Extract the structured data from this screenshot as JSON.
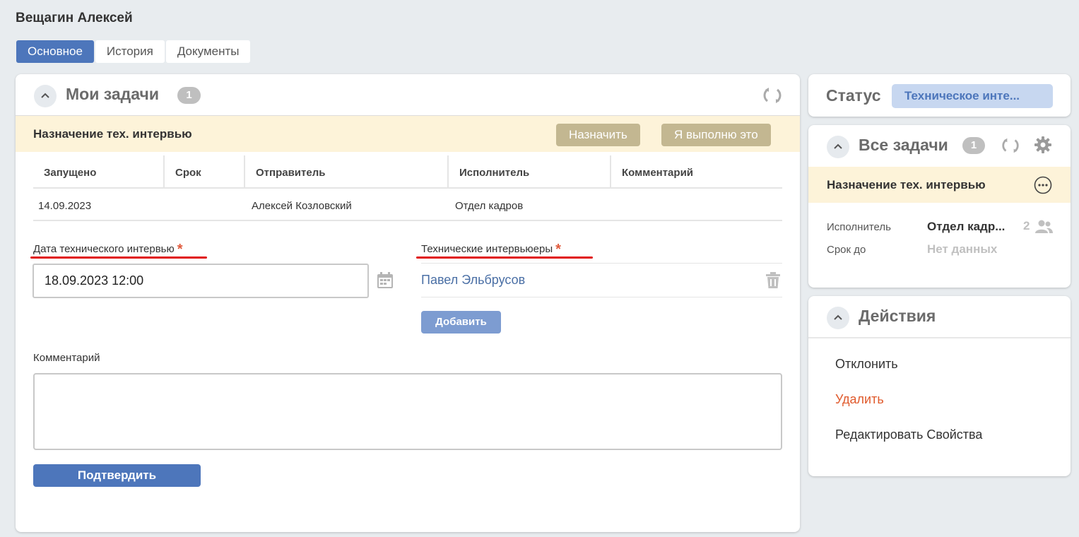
{
  "page": {
    "title": "Вещагин Алексей"
  },
  "tabs": [
    {
      "label": "Основное",
      "active": true
    },
    {
      "label": "История",
      "active": false
    },
    {
      "label": "Документы",
      "active": false
    }
  ],
  "my_tasks": {
    "title": "Мои задачи",
    "count": "1",
    "task_name": "Назначение тех. интервью",
    "assign_label": "Назначить",
    "self_label": "Я выполню это",
    "table": {
      "headers": [
        "Запущено",
        "Срок",
        "Отправитель",
        "Исполнитель",
        "Комментарий"
      ],
      "rows": [
        [
          "14.09.2023",
          "",
          "Алексей Козловский",
          "Отдел кадров",
          ""
        ]
      ]
    },
    "form": {
      "date_label": "Дата технического интервью",
      "date_value": "18.09.2023 12:00",
      "interviewers_label": "Технические интервьюеры",
      "interviewer": "Павел Эльбрусов",
      "add_label": "Добавить",
      "comment_label": "Комментарий",
      "comment_value": "",
      "confirm_label": "Подтвердить",
      "required_mark": "*"
    }
  },
  "status": {
    "label": "Статус",
    "value": "Техническое инте..."
  },
  "all_tasks": {
    "title": "Все задачи",
    "count": "1",
    "task_name": "Назначение тех. интервью",
    "executor_label": "Исполнитель",
    "executor_value": "Отдел кадр...",
    "executor_count": "2",
    "due_label": "Срок до",
    "due_value": "Нет данных"
  },
  "actions": {
    "title": "Действия",
    "items": [
      "Отклонить",
      "Удалить",
      "Редактировать Свойства"
    ]
  },
  "colors": {
    "accent": "#4d76bb",
    "banner": "#fdf3d9",
    "tan_button": "#c3b791",
    "danger": "#e05a2c",
    "required_underline": "#e01010"
  }
}
